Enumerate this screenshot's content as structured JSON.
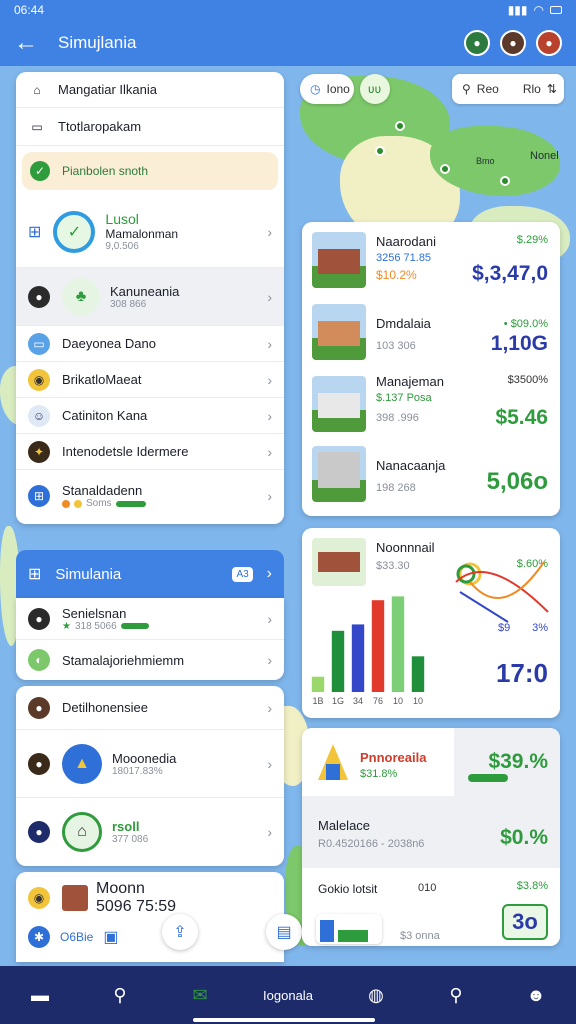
{
  "status": {
    "time": "06:44"
  },
  "header": {
    "title": "Simujlania"
  },
  "map": {
    "chip_left": "Iono",
    "chip_left2": "ʋʋ",
    "chip_search": "Reo",
    "chip_filter": "Rlo",
    "label_a": "Nonel",
    "label_b": "Bmo"
  },
  "menu": {
    "items": [
      {
        "label": "Mangatiar Ilkania",
        "icon": "home-icon"
      },
      {
        "label": "Ttotlaropakam",
        "icon": "document-icon"
      },
      {
        "label": "Pianbolen snoth",
        "icon": "check-icon"
      }
    ]
  },
  "list": {
    "featured": {
      "title": "Lusol",
      "sub": "Mamalonman",
      "meta": "9,0.506"
    },
    "selected": {
      "title": "Kanuneania",
      "meta": "308 866"
    },
    "items": [
      {
        "label": "Daeyonea Dano"
      },
      {
        "label": "BrikatloMaeat"
      },
      {
        "label": "Catiniton Kana"
      },
      {
        "label": "Intenodetsle Idermere"
      },
      {
        "label": "Stanaldadenn",
        "meta": "Soms"
      }
    ]
  },
  "section": {
    "title": "Simulania",
    "badge": "A3"
  },
  "section_items": [
    {
      "label": "Senielsnan",
      "meta": "318 5066"
    },
    {
      "label": "Stamalajoriehmiemm"
    }
  ],
  "people": [
    {
      "label": "Detilhonensiee"
    },
    {
      "label": "Mooonedia",
      "meta": "18017.83%"
    },
    {
      "label": "rsoll",
      "meta": "377 086"
    }
  ],
  "footer_list": {
    "title": "Moonn",
    "meta": "5096 75:59",
    "extra": "O6Bie"
  },
  "places": [
    {
      "name": "Naarodani",
      "meta": "3256 71.85",
      "pct": "$10.2%",
      "change": "$.29%",
      "value": "$,3,47,0"
    },
    {
      "name": "Dmdalaia",
      "meta": "103 306",
      "change": "• $09.0%",
      "value": "1,10G"
    },
    {
      "name": "Manajeman",
      "meta": "$.137 Posa",
      "meta2": "398 .996",
      "change": "$3500%",
      "value": "$5.46"
    },
    {
      "name": "Nanacaanja",
      "meta": "198 268",
      "value": "5,06o"
    }
  ],
  "chart_card": {
    "name": "Noonnnail",
    "meta": "$33.30",
    "change": "$.60%",
    "pct_small": "3%",
    "small_val": "$9",
    "value": "17:0",
    "x_labels": [
      "1B",
      "1G",
      "34",
      "76",
      "10",
      "10"
    ]
  },
  "promo": {
    "title": "Pnnoreaila",
    "meta": "$31.8%",
    "value": "$39.%"
  },
  "stats": [
    {
      "label": "Malelace",
      "meta": "R0.4520166 - 2038n6",
      "value": "$0.%"
    },
    {
      "label": "Gokio lotsit",
      "meta": "$3 onna",
      "mid": "010",
      "change": "$3.8%",
      "value": "3o"
    }
  ],
  "bottom_nav": {
    "center_label": "Iogonala"
  },
  "chart_data": {
    "type": "bar",
    "categories": [
      "1B",
      "1G",
      "34",
      "76",
      "10",
      "10"
    ],
    "series": [
      {
        "values": [
          12,
          48,
          53,
          72,
          75,
          28
        ]
      }
    ],
    "colors": [
      "#9bd86b",
      "#1f8f3b",
      "#3347c8",
      "#e2392d",
      "#7ccf77",
      "#1f8f3b"
    ],
    "ylim": [
      0,
      80
    ]
  }
}
